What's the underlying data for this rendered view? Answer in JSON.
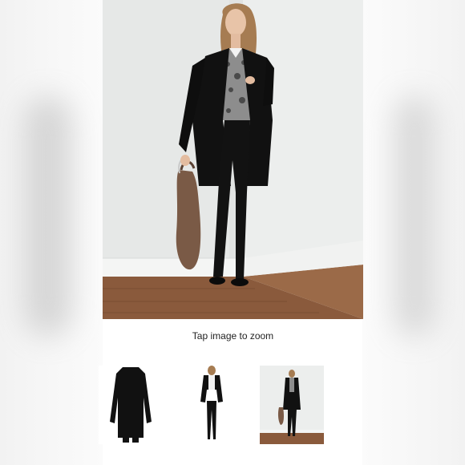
{
  "viewer": {
    "zoom_hint": "Tap image to zoom",
    "main_image_alt": "Model wearing a long black blazer with black skinny pants, snake print blouse, brown hobo bag and black heels"
  },
  "thumbnails": [
    {
      "alt": "Long black blazer, back view"
    },
    {
      "alt": "Model in black blazer and black pants, full length"
    },
    {
      "alt": "Model in black blazer with brown bag, scene view"
    }
  ],
  "colors": {
    "background": "#ffffff",
    "wall": "#e9eceb",
    "floor": "#8a5a3c",
    "garment": "#111111",
    "bag": "#7a5a46",
    "text": "#222222"
  }
}
